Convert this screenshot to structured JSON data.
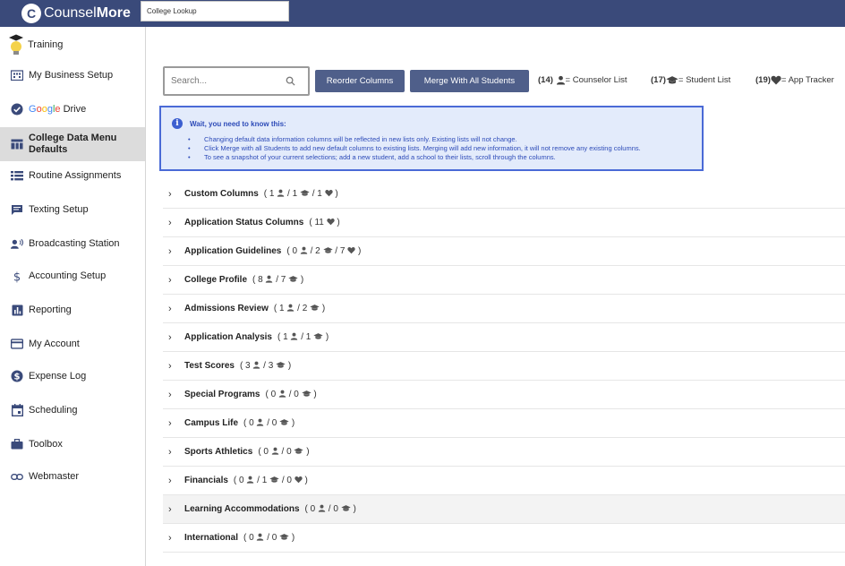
{
  "header": {
    "brand_light": "Counsel",
    "brand_bold": "More",
    "lookup_value": "College Lookup"
  },
  "sidebar": {
    "items": [
      {
        "label": "Training",
        "icon": "lightbulb-cap-icon"
      },
      {
        "label": "My Business Setup",
        "icon": "building-icon"
      },
      {
        "label": "Google Drive",
        "icon": "google-drive-icon"
      },
      {
        "label": "College Data Menu Defaults",
        "icon": "table-icon"
      },
      {
        "label": "Routine Assignments",
        "icon": "list-icon"
      },
      {
        "label": "Texting Setup",
        "icon": "chat-icon"
      },
      {
        "label": "Broadcasting Station",
        "icon": "broadcast-icon"
      },
      {
        "label": "Accounting Setup",
        "icon": "dollar-icon"
      },
      {
        "label": "Reporting",
        "icon": "bar-chart-icon"
      },
      {
        "label": "My Account",
        "icon": "card-icon"
      },
      {
        "label": "Expense Log",
        "icon": "coin-icon"
      },
      {
        "label": "Scheduling",
        "icon": "calendar-icon"
      },
      {
        "label": "Toolbox",
        "icon": "briefcase-icon"
      },
      {
        "label": "Webmaster",
        "icon": "link-icon"
      }
    ],
    "google_word": "Google",
    "drive_word": "Drive"
  },
  "toolbar": {
    "search_placeholder": "Search...",
    "reorder_label": "Reorder Columns",
    "merge_label": "Merge With All Students",
    "counselor_count": "(14)",
    "counselor_label": "= Counselor List",
    "student_count": "(17)",
    "student_label": "= Student List",
    "tracker_count": "(19)",
    "tracker_label": "= App Tracker"
  },
  "alert": {
    "title": "Wait, you need to know this:",
    "lines": [
      "Changing default data information columns will be reflected in new lists only. Existing lists will not change.",
      "Click Merge with all Students to add new default columns to existing lists. Merging will add new information, it will not remove any existing columns.",
      "To see a snapshot of your current selections; add a new student, add a school to their lists, scroll through the columns."
    ]
  },
  "sections": [
    {
      "title": "Custom Columns",
      "counts": [
        {
          "n": "1",
          "icon": "person"
        },
        {
          "n": "1",
          "icon": "cap"
        },
        {
          "n": "1",
          "icon": "heart"
        }
      ]
    },
    {
      "title": "Application Status Columns",
      "counts": [
        {
          "n": "11",
          "icon": "heart"
        }
      ]
    },
    {
      "title": "Application Guidelines",
      "counts": [
        {
          "n": "0",
          "icon": "person"
        },
        {
          "n": "2",
          "icon": "cap"
        },
        {
          "n": "7",
          "icon": "heart"
        }
      ]
    },
    {
      "title": "College Profile",
      "counts": [
        {
          "n": "8",
          "icon": "person"
        },
        {
          "n": "7",
          "icon": "cap"
        }
      ]
    },
    {
      "title": "Admissions Review",
      "counts": [
        {
          "n": "1",
          "icon": "person"
        },
        {
          "n": "2",
          "icon": "cap"
        }
      ]
    },
    {
      "title": "Application Analysis",
      "counts": [
        {
          "n": "1",
          "icon": "person"
        },
        {
          "n": "1",
          "icon": "cap"
        }
      ]
    },
    {
      "title": "Test Scores",
      "counts": [
        {
          "n": "3",
          "icon": "person"
        },
        {
          "n": "3",
          "icon": "cap"
        }
      ]
    },
    {
      "title": "Special Programs",
      "counts": [
        {
          "n": "0",
          "icon": "person"
        },
        {
          "n": "0",
          "icon": "cap"
        }
      ]
    },
    {
      "title": "Campus Life",
      "counts": [
        {
          "n": "0",
          "icon": "person"
        },
        {
          "n": "0",
          "icon": "cap"
        }
      ]
    },
    {
      "title": "Sports Athletics",
      "counts": [
        {
          "n": "0",
          "icon": "person"
        },
        {
          "n": "0",
          "icon": "cap"
        }
      ]
    },
    {
      "title": "Financials",
      "counts": [
        {
          "n": "0",
          "icon": "person"
        },
        {
          "n": "1",
          "icon": "cap"
        },
        {
          "n": "0",
          "icon": "heart"
        }
      ]
    },
    {
      "title": "Learning Accommodations",
      "counts": [
        {
          "n": "0",
          "icon": "person"
        },
        {
          "n": "0",
          "icon": "cap"
        }
      ],
      "highlighted": true
    },
    {
      "title": "International",
      "counts": [
        {
          "n": "0",
          "icon": "person"
        },
        {
          "n": "0",
          "icon": "cap"
        }
      ]
    }
  ],
  "colors": {
    "header_bg": "#3a4a7a",
    "button_bg": "#4f5f8a",
    "alert_bg": "#e3ebfb",
    "alert_border": "#4a6ad6",
    "active_sidebar_bg": "#dcdcdc"
  }
}
